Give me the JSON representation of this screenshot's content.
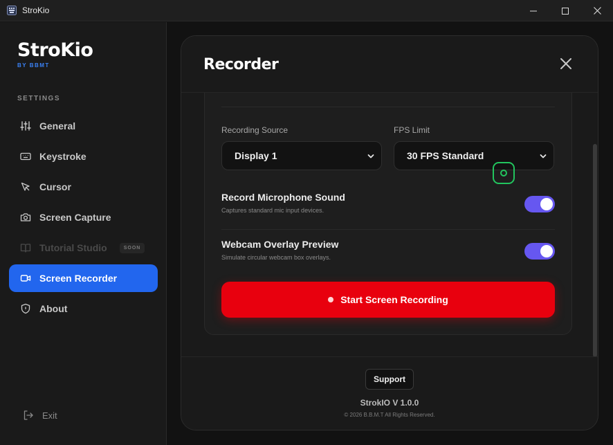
{
  "window": {
    "title": "StroKio",
    "controls": [
      "minimize-icon",
      "maximize-icon",
      "close-icon"
    ]
  },
  "sidebar": {
    "brand_name": "StroKio",
    "brand_sub": "BY BBMT",
    "section_label": "SETTINGS",
    "items": [
      {
        "label": "General",
        "icon": "sliders-icon",
        "state": "normal"
      },
      {
        "label": "Keystroke",
        "icon": "keyboard-icon",
        "state": "normal"
      },
      {
        "label": "Cursor",
        "icon": "cursor-pointer-icon",
        "state": "normal"
      },
      {
        "label": "Screen Capture",
        "icon": "camera-icon",
        "state": "normal"
      },
      {
        "label": "Tutorial Studio",
        "icon": "book-icon",
        "state": "disabled",
        "badge": "SOON"
      },
      {
        "label": "Screen Recorder",
        "icon": "video-icon",
        "state": "active"
      },
      {
        "label": "About",
        "icon": "shield-icon",
        "state": "normal"
      }
    ],
    "exit_label": "Exit"
  },
  "modal": {
    "title": "Recorder",
    "recording_source": {
      "label": "Recording Source",
      "value": "Display 1"
    },
    "fps_limit": {
      "label": "FPS Limit",
      "value": "30 FPS Standard"
    },
    "microphone": {
      "title": "Record Microphone Sound",
      "description": "Captures standard mic input devices.",
      "enabled": true
    },
    "webcam": {
      "title": "Webcam Overlay Preview",
      "description": "Simulate circular webcam box overlays.",
      "enabled": true
    },
    "record_button_label": "Start Screen Recording",
    "footer": {
      "support_label": "Support",
      "version": "StrokIO V 1.0.0",
      "copyright": "© 2026 B.B.M.T All Rights Reserved."
    }
  },
  "colors": {
    "accent_blue": "#2266ee",
    "toggle_purple": "#6657f0",
    "record_red": "#e8000e",
    "focus_green": "#22c55e"
  }
}
